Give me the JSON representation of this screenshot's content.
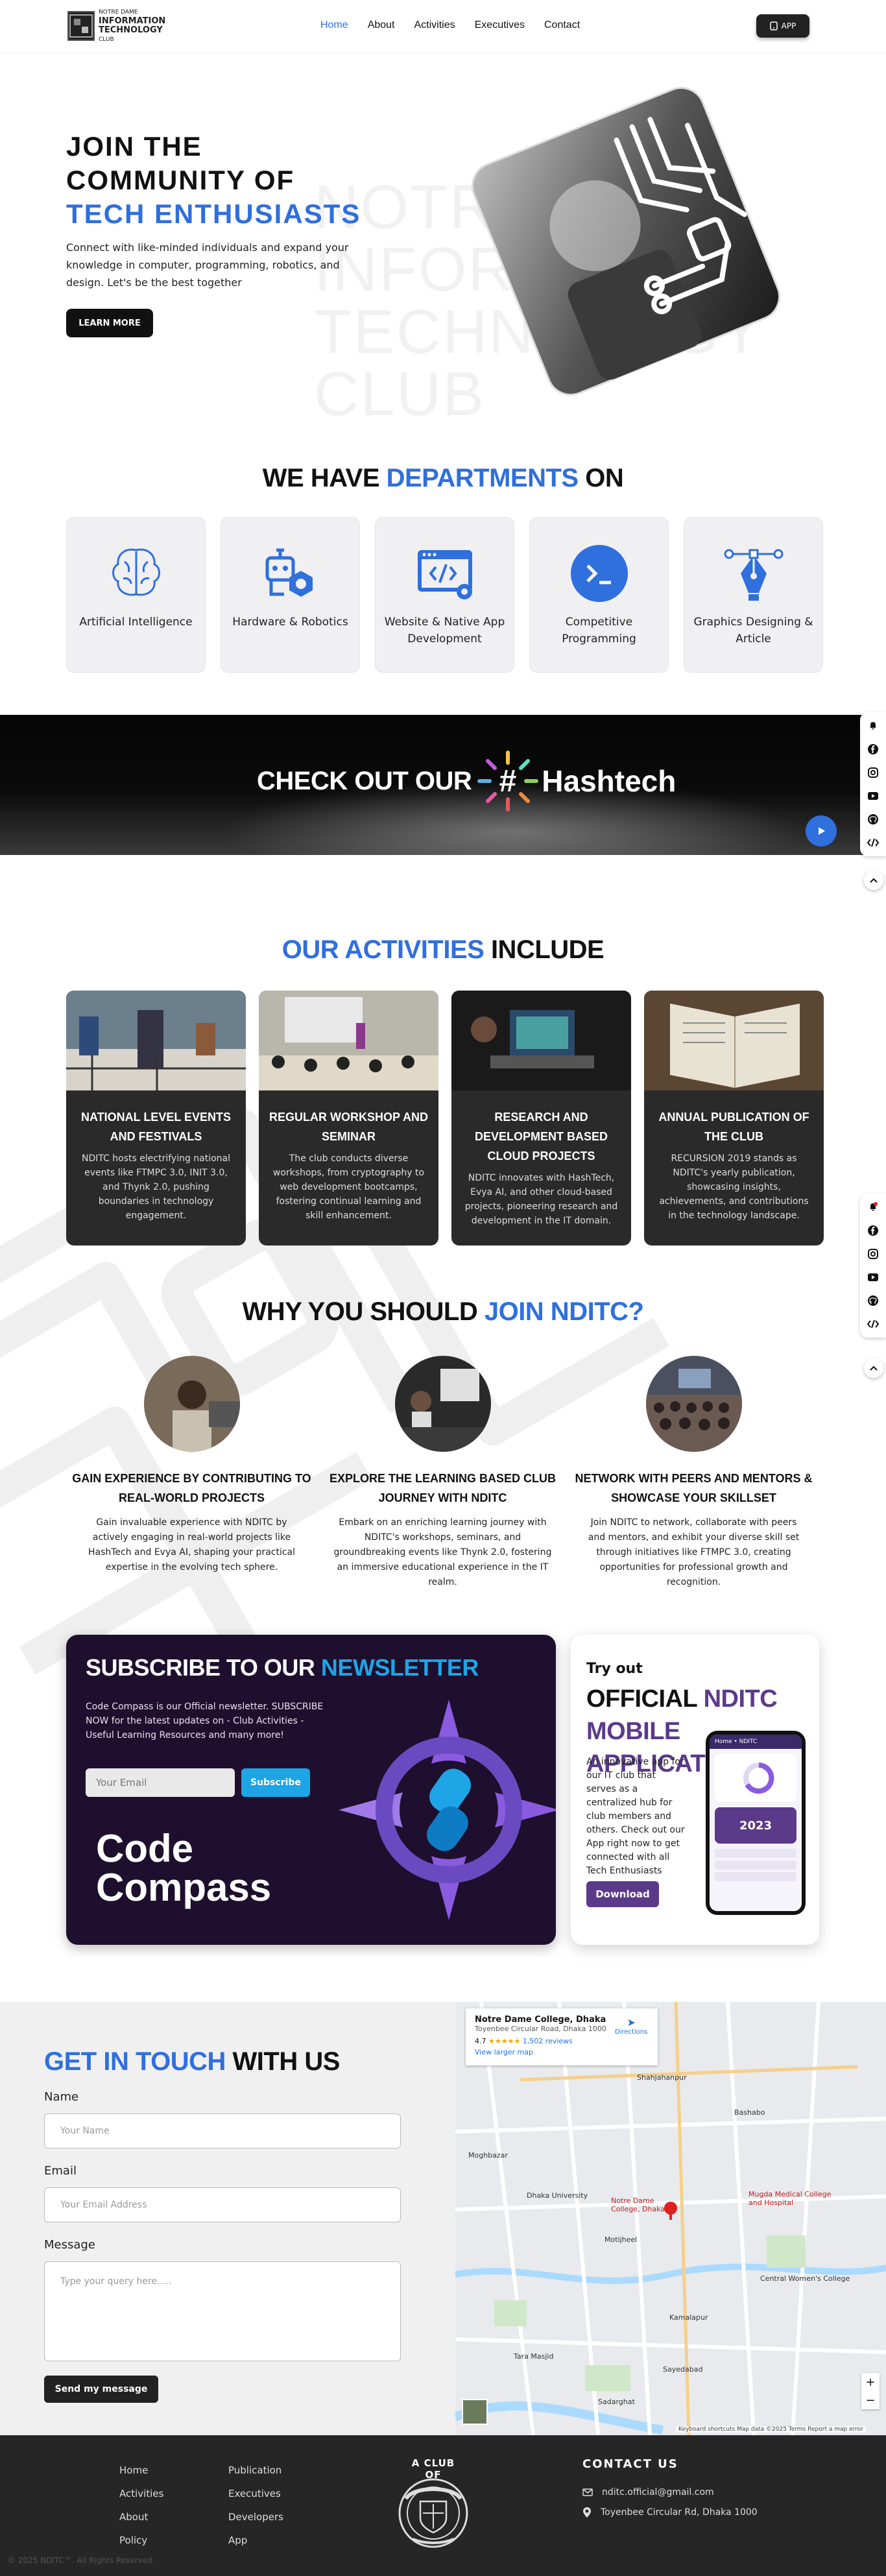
{
  "header": {
    "logo_title": "INFORMATION TECHNOLOGY",
    "logo_sub": "NOTRE DAME",
    "logo_sub2": "CLUB",
    "nav": [
      "Home",
      "About",
      "Activities",
      "Executives",
      "Contact"
    ],
    "app_button": "APP"
  },
  "hero": {
    "line1": "JOIN THE",
    "line2": "COMMUNITY OF",
    "line3": "TECH ENTHUSIASTS",
    "description": "Connect with like-minded individuals and expand your knowledge in computer, programming, robotics, and design. Let's be the best together",
    "cta": "LEARN MORE",
    "watermark": "NOTRE DAME\nINFORMATION\nTECHNOLOGY\nCLUB"
  },
  "departments": {
    "title_a": "WE HAVE ",
    "title_b": "DEPARTMENTS",
    "title_c": " ON",
    "items": [
      {
        "label": "Artificial Intelligence",
        "icon": "brain-icon"
      },
      {
        "label": "Hardware & Robotics",
        "icon": "robot-icon"
      },
      {
        "label": "Website & Native App Development",
        "icon": "code-window-icon"
      },
      {
        "label": "Competitive Programming",
        "icon": "terminal-icon"
      },
      {
        "label": "Graphics Designing & Article",
        "icon": "pen-tool-icon"
      }
    ]
  },
  "hashtech": {
    "prefix": "CHECK OUT OUR",
    "name": "Hashtech"
  },
  "activities": {
    "title_a": "OUR ACTIVITIES",
    "title_b": " INCLUDE",
    "items": [
      {
        "title": "NATIONAL LEVEL EVENTS AND FESTIVALS",
        "desc": "NDITC hosts electrifying national events like FTMPC 3.0, INIT 3.0, and Thynk 2.0, pushing boundaries in technology engagement."
      },
      {
        "title": "REGULAR WORKSHOP AND SEMINAR",
        "desc": "The club conducts diverse workshops, from cryptography to web development bootcamps, fostering continual learning and skill enhancement."
      },
      {
        "title": "RESEARCH AND DEVELOPMENT BASED CLOUD PROJECTS",
        "desc": "NDITC innovates with HashTech, Evya AI, and other cloud-based projects, pioneering research and development in the IT domain."
      },
      {
        "title": "ANNUAL PUBLICATION OF THE CLUB",
        "desc": "RECURSION 2019 stands as NDITC's yearly publication, showcasing insights, achievements, and contributions in the technology landscape."
      }
    ]
  },
  "why": {
    "title_a": "WHY YOU SHOULD ",
    "title_b": "JOIN NDITC?",
    "items": [
      {
        "title": "GAIN EXPERIENCE BY CONTRIBUTING TO REAL-WORLD PROJECTS",
        "desc": "Gain invaluable experience with NDITC by actively engaging in real-world projects like HashTech and Evya AI, shaping your practical expertise in the evolving tech sphere."
      },
      {
        "title": "EXPLORE THE LEARNING BASED CLUB JOURNEY WITH NDITC",
        "desc": "Embark on an enriching learning journey with NDITC's workshops, seminars, and groundbreaking events like Thynk 2.0, fostering an immersive educational experience in the IT realm."
      },
      {
        "title": "NETWORK WITH PEERS AND MENTORS & SHOWCASE YOUR SKILLSET",
        "desc": "Join NDITC to network, collaborate with peers and mentors, and exhibit your diverse skill set through initiatives like FTMPC 3.0, creating opportunities for professional growth and recognition."
      }
    ]
  },
  "subscribe": {
    "title_a": "SUBSCRIBE TO OUR ",
    "title_b": "NEWSLETTER",
    "desc": "Code Compass is our Official newsletter. SUBSCRIBE NOW for the latest updates on - Club Activities - Useful Learning Resources and many more!",
    "placeholder": "Your Email",
    "button": "Subscribe",
    "brand_line1": "Code",
    "brand_line2": "Compass"
  },
  "app": {
    "try": "Try out",
    "title_a": "OFFICIAL ",
    "title_b": "NDITC MOBILE APPLICATION",
    "desc": "An innovative app for our IT club that serves as a centralized hub for club members and others. Check out our App right now to get connected with all Tech Enthusiasts",
    "button": "Download",
    "phone_header": "Home • NDITC",
    "phone_card": "2023"
  },
  "contact": {
    "title_a": "GET IN TOUCH",
    "title_b": " WITH US",
    "name_label": "Name",
    "name_placeholder": "Your Name",
    "email_label": "Email",
    "email_placeholder": "Your Email Address",
    "message_label": "Message",
    "message_placeholder": "Type your query here.....",
    "send": "Send my message"
  },
  "map": {
    "place": "Notre Dame College, Dhaka",
    "address": "Toyenbee Circular Road, Dhaka 1000",
    "rating": "4.7",
    "stars": "★★★★★",
    "reviews": "1,502 reviews",
    "directions": "Directions",
    "larger": "View larger map",
    "pin_label": "Notre Dame College, Dhaka",
    "footer_text": "Keyboard shortcuts  Map data ©2025  Terms  Report a map error",
    "labels": [
      "Moghbazar",
      "Dhaka University",
      "Motijheel",
      "Kamalapur",
      "Sayedabad",
      "Bashabo",
      "Shahjahanpur",
      "Mugda Medical College and Hospital",
      "Central Women's College",
      "Tara Masjid",
      "Sadarghat"
    ]
  },
  "footer": {
    "col1": [
      "Home",
      "Activities",
      "About",
      "Policy"
    ],
    "col2": [
      "Publication",
      "Executives",
      "Developers",
      "App"
    ],
    "club_label": "A CLUB OF",
    "contact_title": "CONTACT US",
    "email": "nditc.official@gmail.com",
    "address": "Toyenbee Circular Rd, Dhaka 1000",
    "copyright": "© 2025 NDITC™. All Rights Reserved."
  }
}
